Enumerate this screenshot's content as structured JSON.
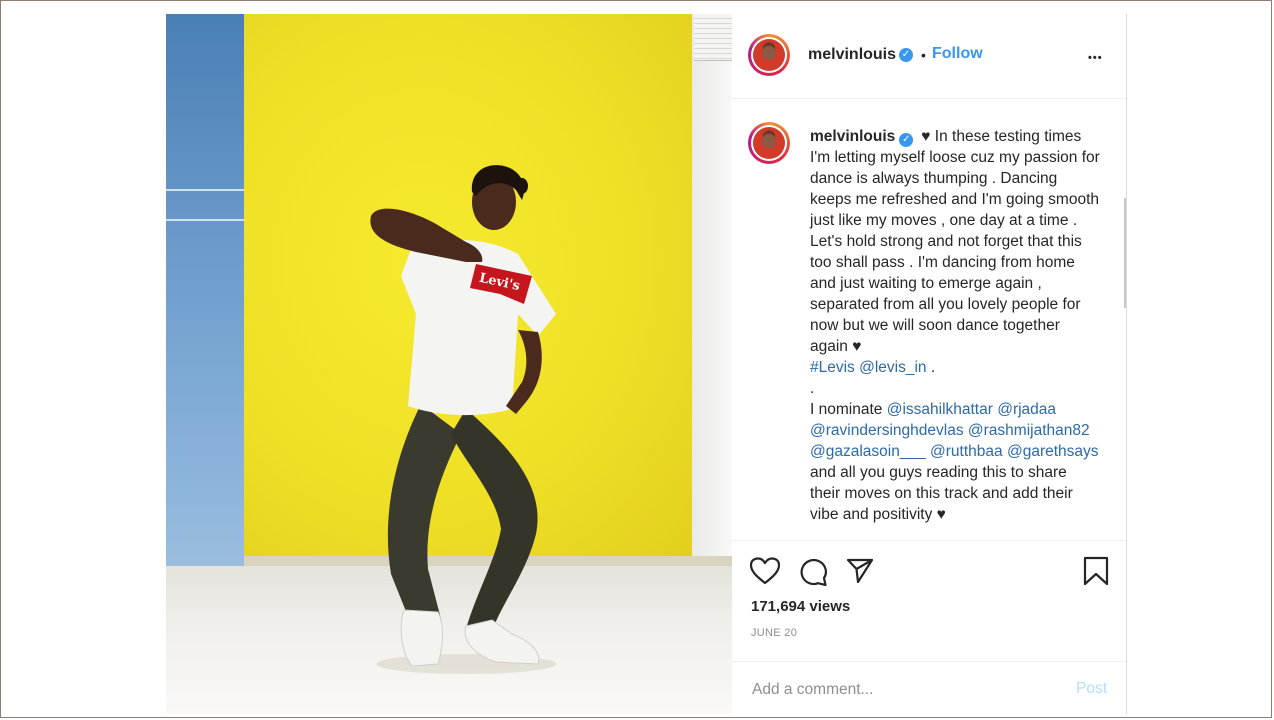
{
  "post": {
    "username": "melvinlouis",
    "follow_label": "Follow",
    "separator": "•",
    "more_label": "•••",
    "caption": {
      "username": "melvinlouis",
      "heart": "♥",
      "body1": "In these testing times I'm letting myself loose cuz my passion for dance is always thumping . Dancing keeps me refreshed and I'm going smooth just like my moves , one day at a time . Let's hold strong and not forget that this too shall pass . I'm dancing from home and just waiting to emerge again , separated from all you lovely people for now but we will soon dance together again ♥",
      "tag_levis": "#Levis",
      "mention_levis_in": "@levis_in",
      "end_dot": ".",
      "dot_line": ".",
      "nominate_intro": "I nominate",
      "mentions": [
        "@issahilkhattar",
        "@rjadaa",
        "@ravindersinghdevlas",
        "@rashmijathan82",
        "@gazalasoin___",
        "@rutthbaa",
        "@garethsays"
      ],
      "nominate_outro": "and all you guys reading this to share their moves on this track and add their vibe and positivity ♥"
    },
    "views": "171,694 views",
    "date": "JUNE 20",
    "comment_placeholder": "Add a comment...",
    "post_label": "Post"
  },
  "colors": {
    "accent": "#3897f0",
    "wall": "#efe026",
    "post_disabled": "#b2dffc"
  },
  "icons": [
    "verified-badge-icon",
    "more-options-icon",
    "heart-icon",
    "comment-icon",
    "share-icon",
    "bookmark-icon"
  ],
  "media": {
    "shirt_logo": "Levi's"
  }
}
